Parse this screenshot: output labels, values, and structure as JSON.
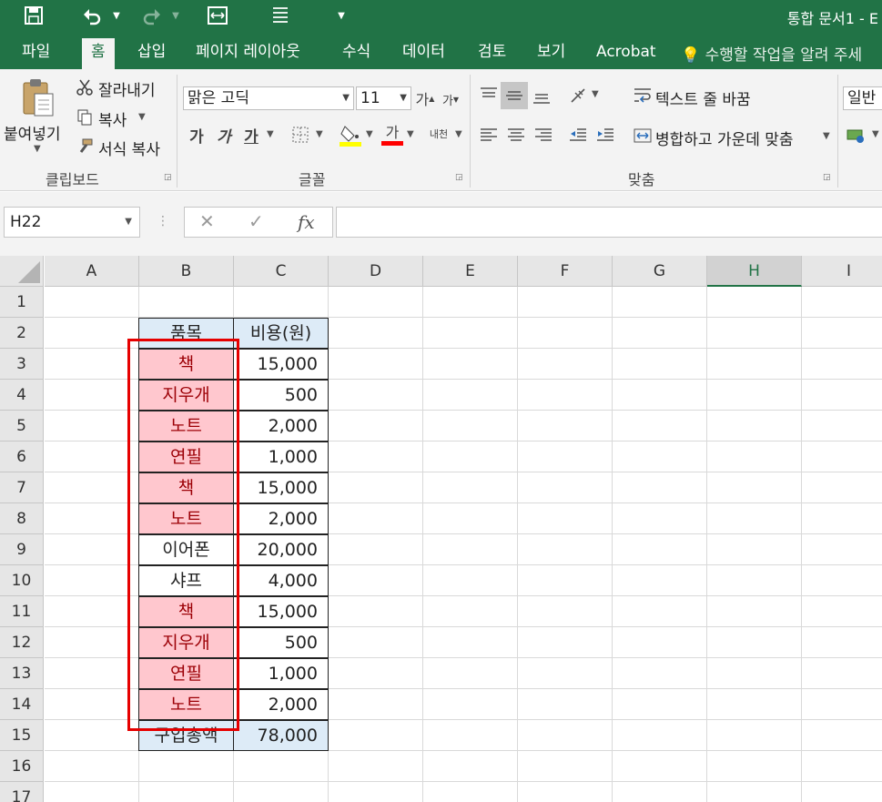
{
  "window": {
    "title": "통합 문서1 - E"
  },
  "quick_access": {
    "save_icon": "save-icon",
    "undo_icon": "undo-icon",
    "redo_icon": "redo-icon"
  },
  "tabs": [
    {
      "label": "파일"
    },
    {
      "label": "홈"
    },
    {
      "label": "삽입"
    },
    {
      "label": "페이지 레이아웃"
    },
    {
      "label": "수식"
    },
    {
      "label": "데이터"
    },
    {
      "label": "검토"
    },
    {
      "label": "보기"
    },
    {
      "label": "Acrobat"
    }
  ],
  "tell_me": "수행할 작업을 알려 주세",
  "ribbon": {
    "clipboard": {
      "paste": "붙여넣기",
      "cut": "잘라내기",
      "copy": "복사",
      "format_painter": "서식 복사",
      "label": "클립보드"
    },
    "font": {
      "font_name": "맑은 고딕",
      "font_size": "11",
      "bold": "가",
      "italic": "가",
      "underline": "가",
      "font_color_char": "가",
      "label": "글꼴"
    },
    "alignment": {
      "wrap_text": "텍스트 줄 바꿈",
      "merge_center": "병합하고 가운데 맞춤",
      "label": "맞춤"
    },
    "number": {
      "format": "일반"
    },
    "accent_colors": {
      "highlight": "#ffff00",
      "font_color": "#ff0000"
    }
  },
  "formula_bar": {
    "name_box": "H22",
    "cancel": "✕",
    "enter": "✓",
    "fx": "fx",
    "content": ""
  },
  "columns": [
    "A",
    "B",
    "C",
    "D",
    "E",
    "F",
    "G",
    "H",
    "I"
  ],
  "selected_column": "H",
  "rows": [
    "1",
    "2",
    "3",
    "4",
    "5",
    "6",
    "7",
    "8",
    "9",
    "10",
    "11",
    "12",
    "13",
    "14",
    "15",
    "16",
    "17"
  ],
  "table": {
    "header": {
      "item": "품목",
      "cost": "비용(원)"
    },
    "items": [
      {
        "item": "책",
        "cost": "15,000",
        "highlight": true
      },
      {
        "item": "지우개",
        "cost": "500",
        "highlight": true
      },
      {
        "item": "노트",
        "cost": "2,000",
        "highlight": true
      },
      {
        "item": "연필",
        "cost": "1,000",
        "highlight": true
      },
      {
        "item": "책",
        "cost": "15,000",
        "highlight": true
      },
      {
        "item": "노트",
        "cost": "2,000",
        "highlight": true
      },
      {
        "item": "이어폰",
        "cost": "20,000",
        "highlight": false
      },
      {
        "item": "샤프",
        "cost": "4,000",
        "highlight": false
      },
      {
        "item": "책",
        "cost": "15,000",
        "highlight": true
      },
      {
        "item": "지우개",
        "cost": "500",
        "highlight": true
      },
      {
        "item": "연필",
        "cost": "1,000",
        "highlight": true
      },
      {
        "item": "노트",
        "cost": "2,000",
        "highlight": true
      }
    ],
    "total": {
      "label": "구입총액",
      "value": "78,000"
    }
  }
}
